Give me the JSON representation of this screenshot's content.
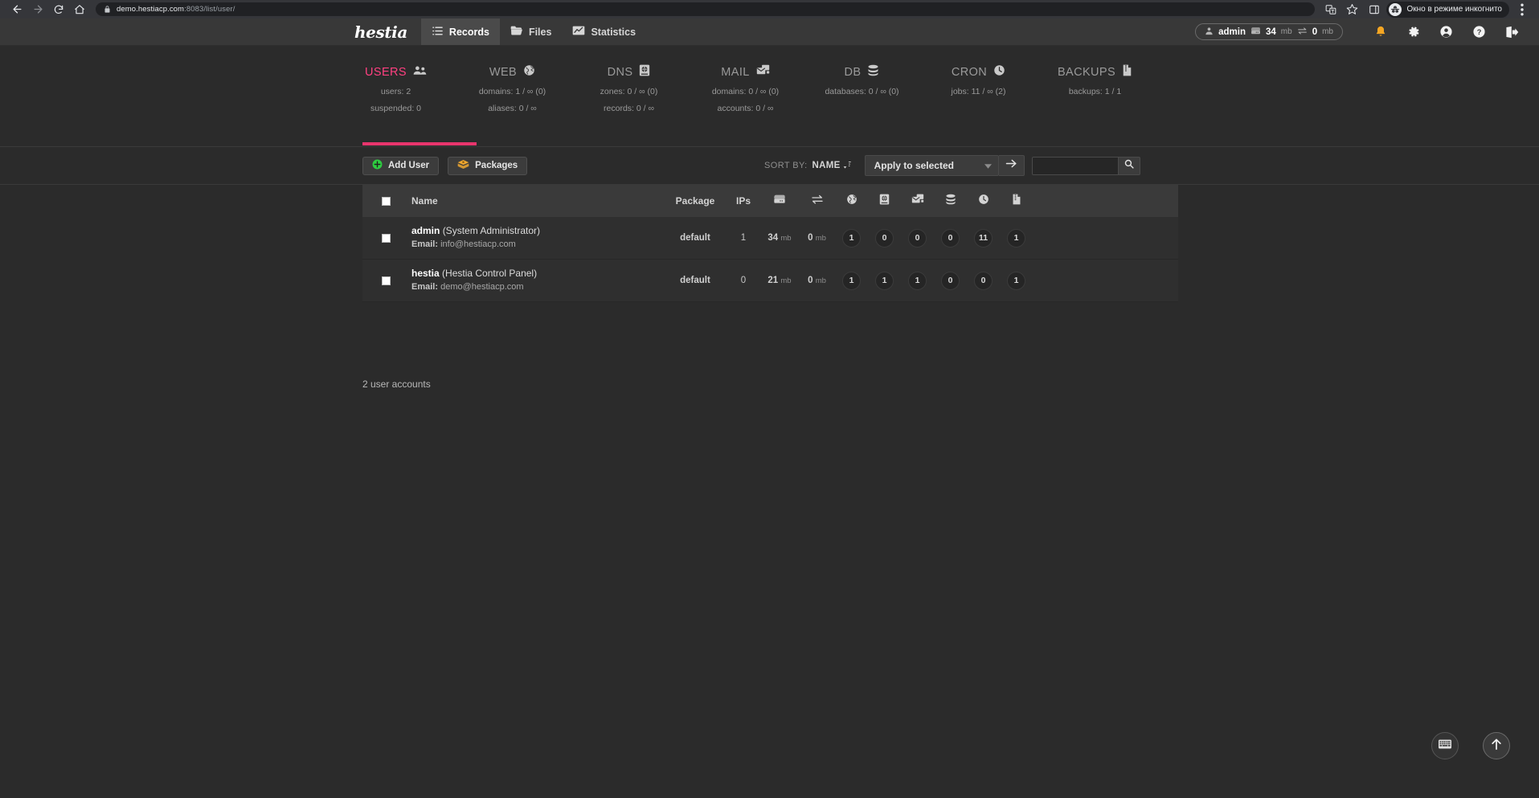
{
  "browser": {
    "back_icon": "back-arrow-icon",
    "forward_icon": "forward-arrow-icon",
    "reload_icon": "reload-icon",
    "home_icon": "home-icon",
    "url_secure": "demo.hestiacp.com",
    "url_rest": ":8083/list/user/",
    "translate_icon": "translate-icon",
    "bookmark_icon": "star-icon",
    "sidepanel_icon": "side-panel-icon",
    "incognito_label": "Окно в режиме инкогнито",
    "menu_icon": "kebab-menu-icon"
  },
  "topnav": {
    "brand": "hestia",
    "menu": [
      {
        "label": "Records",
        "icon": "list-records-icon",
        "active": true
      },
      {
        "label": "Files",
        "icon": "folder-icon",
        "active": false
      },
      {
        "label": "Statistics",
        "icon": "chart-icon",
        "active": false
      }
    ],
    "user": {
      "name": "admin",
      "disk": "34",
      "disk_unit": "mb",
      "bandwidth": "0",
      "bandwidth_unit": "mb",
      "user_icon": "user-icon",
      "disk_icon": "disk-icon",
      "bandwidth_icon": "transfer-icon"
    },
    "actions": [
      {
        "name": "notifications-icon"
      },
      {
        "name": "gear-icon"
      },
      {
        "name": "account-icon"
      },
      {
        "name": "help-icon"
      },
      {
        "name": "logout-icon"
      }
    ]
  },
  "stats": {
    "accent": "#ff4081",
    "underline_color": "#e8356d",
    "columns": [
      {
        "title": "USERS",
        "icon": "users-icon",
        "active": true,
        "lines": [
          "users: 2",
          "suspended: 0"
        ]
      },
      {
        "title": "WEB",
        "icon": "globe-icon",
        "active": false,
        "lines": [
          "domains: 1 / ∞ (0)",
          "aliases: 0 / ∞"
        ]
      },
      {
        "title": "DNS",
        "icon": "dns-icon",
        "active": false,
        "lines": [
          "zones: 0 / ∞ (0)",
          "records: 0 / ∞"
        ]
      },
      {
        "title": "MAIL",
        "icon": "mail-icon",
        "active": false,
        "lines": [
          "domains: 0 / ∞ (0)",
          "accounts: 0 / ∞"
        ]
      },
      {
        "title": "DB",
        "icon": "database-icon",
        "active": false,
        "lines": [
          "databases: 0 / ∞ (0)",
          ""
        ]
      },
      {
        "title": "CRON",
        "icon": "clock-icon",
        "active": false,
        "lines": [
          "jobs: 11 / ∞ (2)",
          ""
        ]
      },
      {
        "title": "BACKUPS",
        "icon": "backup-icon",
        "active": false,
        "lines": [
          "backups: 1 / 1",
          ""
        ]
      }
    ]
  },
  "toolbar": {
    "add_user_label": "Add User",
    "add_user_icon": "plus-circle-icon",
    "packages_label": "Packages",
    "packages_icon": "packages-icon",
    "sort_label": "SORT BY:",
    "sort_value": "NAME",
    "sort_icon": "sort-arrows-icon",
    "apply_selected_label": "Apply to selected",
    "apply_selected_caret": "chevron-down-icon",
    "apply_go_icon": "arrow-right-icon",
    "search_value": "",
    "search_placeholder": "",
    "search_icon": "search-icon"
  },
  "table": {
    "headers": {
      "select_all": "select-all-checkbox",
      "name": "Name",
      "package": "Package",
      "ips": "IPs",
      "disk_icon": "disk-icon",
      "bandwidth_icon": "transfer-icon",
      "web_icon": "globe-icon",
      "dns_icon": "dns-icon",
      "mail_icon": "mail-icon",
      "db_icon": "database-icon",
      "cron_icon": "clock-icon",
      "backup_icon": "backup-icon"
    },
    "rows": [
      {
        "user": "admin",
        "description": "(System Administrator)",
        "email_label": "Email:",
        "email": "info@hestiacp.com",
        "package": "default",
        "ips": "1",
        "disk": "34",
        "disk_unit": "mb",
        "bandwidth": "0",
        "bandwidth_unit": "mb",
        "counts": [
          "1",
          "0",
          "0",
          "0",
          "11",
          "1"
        ]
      },
      {
        "user": "hestia",
        "description": "(Hestia Control Panel)",
        "email_label": "Email:",
        "email": "demo@hestiacp.com",
        "package": "default",
        "ips": "0",
        "disk": "21",
        "disk_unit": "mb",
        "bandwidth": "0",
        "bandwidth_unit": "mb",
        "counts": [
          "1",
          "1",
          "1",
          "0",
          "0",
          "1"
        ]
      }
    ]
  },
  "footer": {
    "count_text": "2 user accounts"
  },
  "floating": [
    {
      "name": "keyboard-shortcuts-button",
      "icon": "keyboard-icon"
    },
    {
      "name": "scroll-to-top-button",
      "icon": "arrow-up-icon"
    }
  ]
}
